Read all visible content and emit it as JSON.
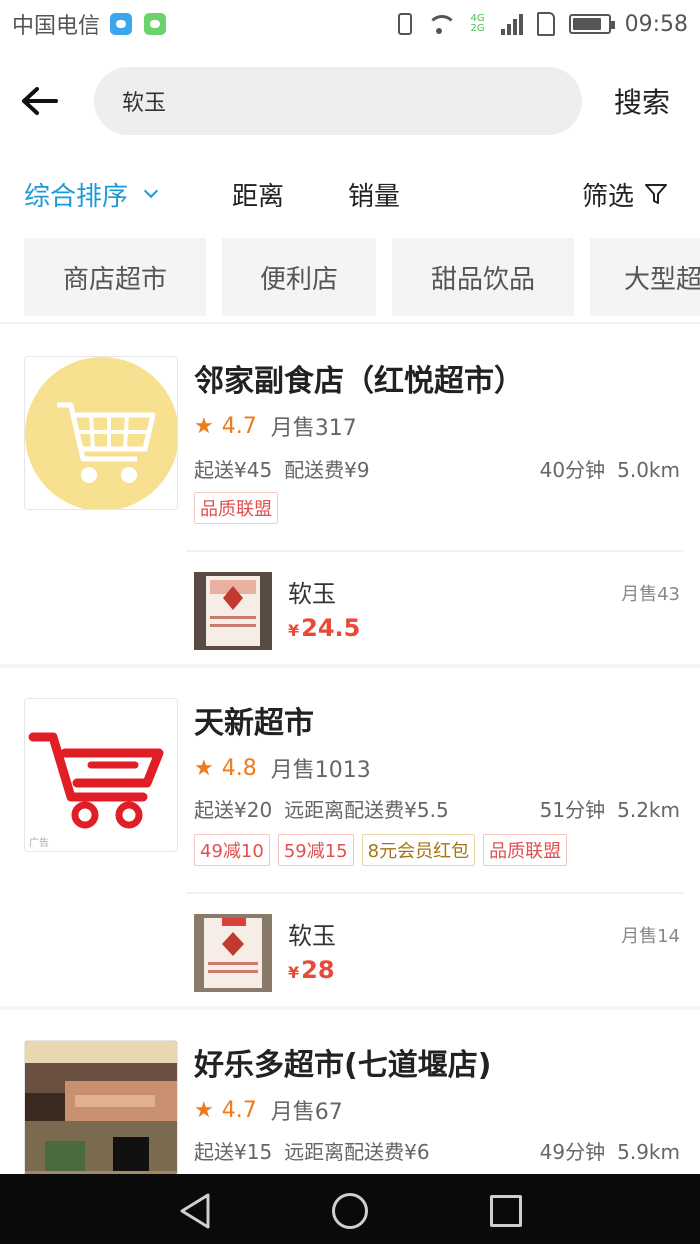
{
  "status_bar": {
    "carrier": "中国电信",
    "network": [
      "4G",
      "2G"
    ],
    "time": "09:58",
    "battery_level": 0.85
  },
  "header": {
    "back_icon": "arrow-left-icon",
    "search_value": "软玉",
    "search_button": "搜索"
  },
  "sort_bar": {
    "items": [
      {
        "label": "综合排序",
        "active": true
      },
      {
        "label": "距离",
        "active": false
      },
      {
        "label": "销量",
        "active": false
      }
    ],
    "filter_label": "筛选"
  },
  "categories": [
    "商店超市",
    "便利店",
    "甜品饮品",
    "大型超"
  ],
  "colors": {
    "accent": "#1a9bd7",
    "price": "#e84a3a",
    "rating": "#f07a1a"
  },
  "stores": [
    {
      "name": "邻家副食店（红悦超市）",
      "rating": "4.7",
      "monthly_sales": "月售317",
      "min_order": "起送¥45",
      "delivery_fee": "配送费¥9",
      "time": "40分钟",
      "distance": "5.0km",
      "tags": [
        "品质联盟"
      ],
      "logo_icon": "shopping-cart-icon",
      "product": {
        "name": "软玉",
        "price_symbol": "¥",
        "price": "24.5",
        "sales": "月售43"
      }
    },
    {
      "name": "天新超市",
      "rating": "4.8",
      "monthly_sales": "月售1013",
      "min_order": "起送¥20",
      "delivery_fee": "远距离配送费¥5.5",
      "time": "51分钟",
      "distance": "5.2km",
      "tags": [
        "49减10",
        "59减15",
        "8元会员红包",
        "品质联盟"
      ],
      "ad_label": "广告",
      "logo_icon": "shopping-cart-icon",
      "product": {
        "name": "软玉",
        "price_symbol": "¥",
        "price": "28",
        "sales": "月售14"
      }
    },
    {
      "name": "好乐多超市(七道堰店)",
      "rating": "4.7",
      "monthly_sales": "月售67",
      "min_order": "起送¥15",
      "delivery_fee": "远距离配送费¥6",
      "time": "49分钟",
      "distance": "5.9km",
      "logo_icon": "store-photo-icon"
    }
  ]
}
